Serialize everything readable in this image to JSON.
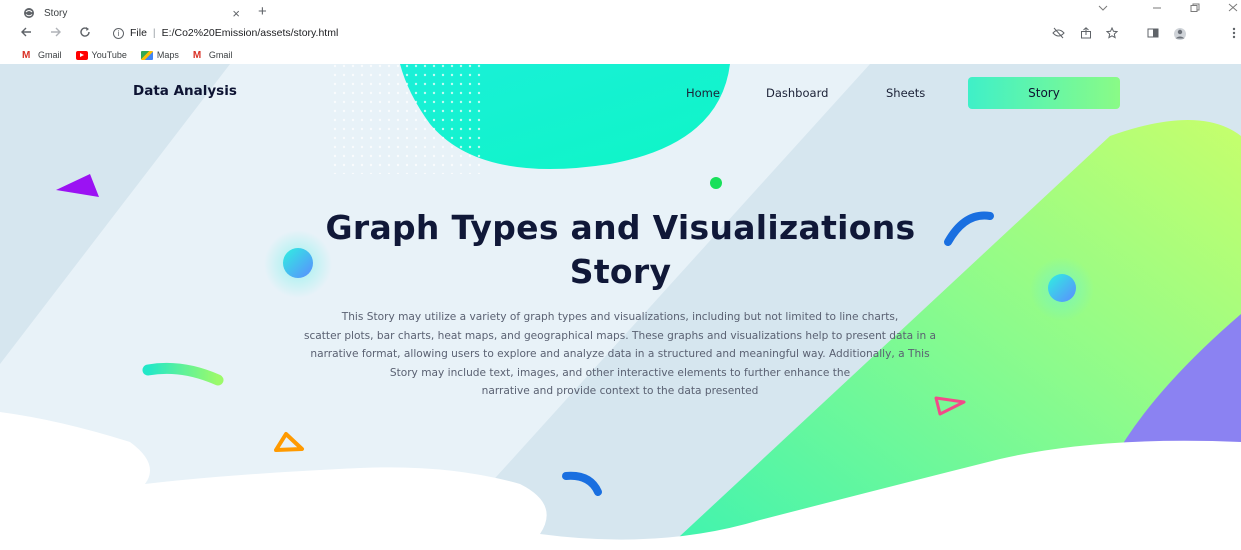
{
  "browser": {
    "tab_title": "Story",
    "tab_close": "×",
    "new_tab": "+",
    "url_prefix": "File",
    "url": "E:/Co2%20Emission/assets/story.html",
    "bookmarks": [
      {
        "label": "Gmail",
        "icon": "gmail-icon"
      },
      {
        "label": "YouTube",
        "icon": "youtube-icon"
      },
      {
        "label": "Maps",
        "icon": "maps-icon"
      },
      {
        "label": "Gmail",
        "icon": "gmail-icon"
      }
    ]
  },
  "header": {
    "logo": "Data Analysis",
    "nav": [
      "Home",
      "Dashboard",
      "Sheets"
    ],
    "active_nav": "Story"
  },
  "hero": {
    "title_line1": "Graph Types and Visualizations",
    "title_line2": "Story",
    "description_lines": [
      "This Story may utilize a variety of graph types and visualizations, including but not limited to line charts,",
      "scatter plots, bar charts, heat maps, and geographical maps. These graphs and visualizations help to present data in a",
      "narrative format, allowing users to explore and analyze data in a structured and meaningful way. Additionally, a This",
      "Story may include text, images, and other interactive elements to further enhance the",
      "narrative and provide context to the data presented"
    ]
  },
  "colors": {
    "accent_gradient_start": "#3ff0c8",
    "accent_gradient_end": "#8afb86",
    "title": "#101838",
    "background": "#d6e6ef"
  }
}
